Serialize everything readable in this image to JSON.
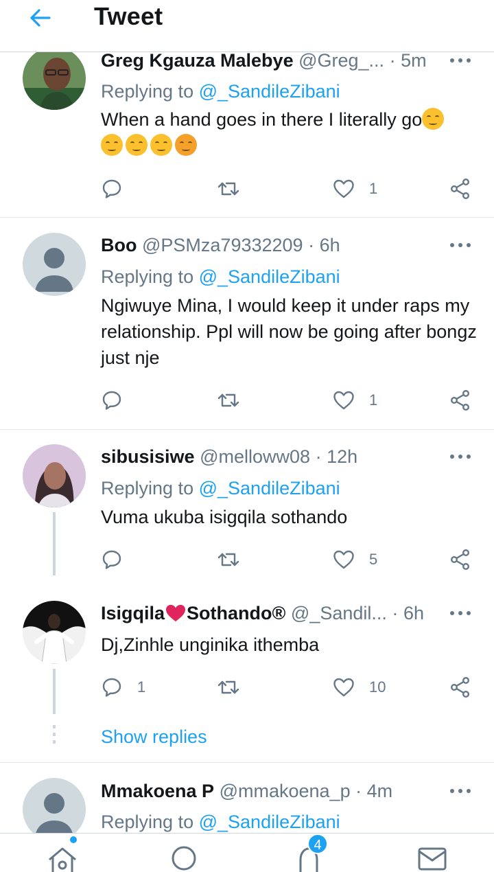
{
  "header": {
    "title": "Tweet"
  },
  "tweets": [
    {
      "name": "Greg Kgauza Malebye",
      "handle": "@Greg_...",
      "separator": "·",
      "time": "5m",
      "replying_prefix": "Replying to",
      "replying_to": "@_SandileZibani",
      "text": "When a hand goes in there I literally go",
      "reply_count": "",
      "like_count": "1"
    },
    {
      "name": "Boo",
      "handle": "@PSMza79332209",
      "separator": "·",
      "time": "6h",
      "replying_prefix": "Replying to",
      "replying_to": "@_SandileZibani",
      "text": "Ngiwuye Mina, I would keep it under raps my relationship. Ppl will now be going after bongz just nje",
      "reply_count": "",
      "like_count": "1"
    },
    {
      "name": "sibusisiwe",
      "handle": "@melloww08",
      "separator": "·",
      "time": "12h",
      "replying_prefix": "Replying to",
      "replying_to": "@_SandileZibani",
      "text": "Vuma ukuba isigqila sothando",
      "reply_count": "",
      "like_count": "5"
    },
    {
      "name_part1": "Isigqila",
      "name_part2": "Sothando®",
      "handle": "@_Sandil...",
      "separator": "·",
      "time": "6h",
      "text": "Dj,Zinhle unginika ithemba",
      "reply_count": "1",
      "like_count": "10"
    },
    {
      "name": "Mmakoena P",
      "handle": "@mmakoena_p",
      "separator": "·",
      "time": "4m",
      "replying_prefix": "Replying to",
      "replying_to": "@_SandileZibani"
    }
  ],
  "show_replies": "Show replies",
  "bottom_nav": {
    "notifications_badge": "4"
  },
  "colors": {
    "accent": "#1da1f2",
    "heart": "#e0245e",
    "muted": "#657786"
  },
  "icons": [
    "back-arrow-icon",
    "more-icon",
    "reply-icon",
    "retweet-icon",
    "like-icon",
    "share-icon",
    "home-icon",
    "search-icon",
    "notifications-icon",
    "messages-icon",
    "heart-emoji-icon"
  ]
}
